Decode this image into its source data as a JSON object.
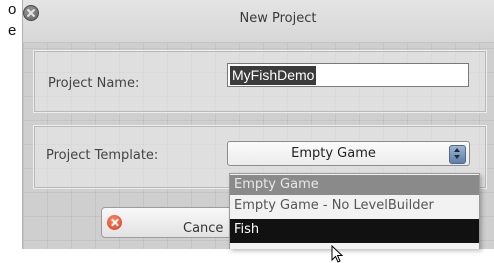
{
  "background_fragment": [
    "o",
    "e"
  ],
  "dialog": {
    "title": "New Project",
    "project_name_label": "Project Name:",
    "project_name_value": "MyFishDemo",
    "project_template_label": "Project Template:",
    "template_selected": "Empty Game",
    "template_options": [
      "Empty Game",
      "Empty Game - No LevelBuilder",
      "Fish"
    ],
    "cancel_label": "Cance"
  },
  "icons": {
    "close": "close-icon",
    "select_arrows": "select-arrows-icon",
    "cancel": "cancel-icon",
    "cursor": "mouse-pointer-icon"
  },
  "colors": {
    "dialog_bg": "#cfcfcf",
    "selection_bg": "#3b3b3b",
    "highlight_option": "#111111",
    "cancel_icon": "#d8381e"
  }
}
